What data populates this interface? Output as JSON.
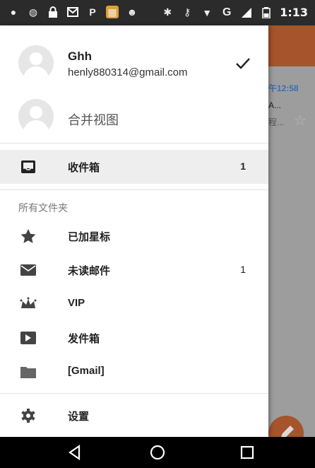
{
  "status_bar": {
    "time": "1:13",
    "network": "G"
  },
  "background": {
    "mail_time": "午12:58",
    "mail_line1": "A...",
    "mail_line2": "程..."
  },
  "drawer": {
    "account": {
      "name": "Ghh",
      "email": "henly880314@gmail.com"
    },
    "merged_view": "合并视图",
    "inbox": {
      "label": "收件箱",
      "count": "1"
    },
    "section_title": "所有文件夹",
    "folders": [
      {
        "label": "已加星标",
        "icon": "star-icon",
        "count": ""
      },
      {
        "label": "未读邮件",
        "icon": "envelope-icon",
        "count": "1"
      },
      {
        "label": "VIP",
        "icon": "crown-icon",
        "count": ""
      },
      {
        "label": "发件箱",
        "icon": "outbox-icon",
        "count": ""
      },
      {
        "label": "[Gmail]",
        "icon": "folder-icon",
        "count": ""
      }
    ],
    "settings": "设置"
  },
  "colors": {
    "accent": "#a5542b",
    "status_bar": "#2b2b2b",
    "selected": "#eeeeee"
  }
}
